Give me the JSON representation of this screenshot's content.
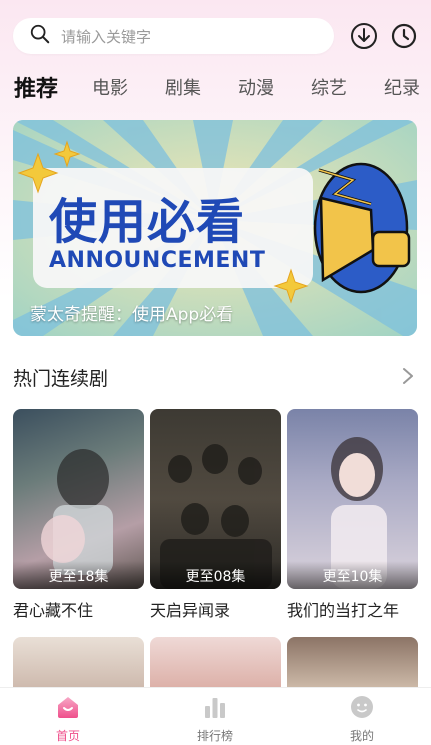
{
  "search": {
    "placeholder": "请输入关键字"
  },
  "tabs": [
    "推荐",
    "电影",
    "剧集",
    "动漫",
    "综艺",
    "纪录"
  ],
  "banner": {
    "title": "使用必看",
    "subtitle": "ANNOUNCEMENT",
    "caption": "蒙太奇提醒：使用App必看"
  },
  "section": {
    "title": "热门连续剧"
  },
  "dramas": [
    {
      "name": "君心藏不住",
      "episodes": "更至18集"
    },
    {
      "name": "天启异闻录",
      "episodes": "更至08集"
    },
    {
      "name": "我们的当打之年",
      "episodes": "更至10集"
    }
  ],
  "nav": [
    {
      "label": "首页"
    },
    {
      "label": "排行榜"
    },
    {
      "label": "我的"
    }
  ],
  "colors": {
    "accent": "#ef4f8b",
    "banner_blue": "#1f49b6"
  }
}
